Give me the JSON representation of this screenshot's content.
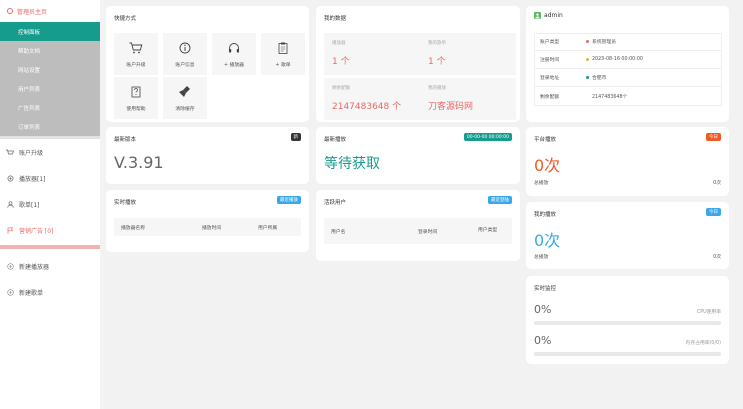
{
  "sidebar": {
    "home": "管理员主页",
    "sub_items": [
      "控制面板",
      "帮助文档",
      "网站设置",
      "用户列表",
      "广告列表",
      "订单列表"
    ],
    "items": [
      {
        "label": "账户升级",
        "icon": "cart-icon"
      },
      {
        "label": "播放器[1]",
        "icon": "gear-icon"
      },
      {
        "label": "歌单[1]",
        "icon": "user-icon"
      },
      {
        "label": "营销广告 [0]",
        "icon": "flag-icon"
      },
      {
        "label": "新建播放器",
        "icon": "plus-circle-icon"
      },
      {
        "label": "新建歌单",
        "icon": "plus-circle-icon"
      }
    ]
  },
  "shortcuts": {
    "title": "快捷方式",
    "items": [
      {
        "label": "账户升级",
        "icon": "cart-icon"
      },
      {
        "label": "账户信息",
        "icon": "info-icon"
      },
      {
        "label": "+ 播放器",
        "icon": "headphones-icon"
      },
      {
        "label": "+ 歌单",
        "icon": "clipboard-icon"
      },
      {
        "label": "使用帮助",
        "icon": "help-icon"
      },
      {
        "label": "清除缓存",
        "icon": "broom-icon"
      }
    ]
  },
  "data_panel": {
    "title": "我的数据",
    "tiles": [
      {
        "label": "播放器",
        "value": "1 个"
      },
      {
        "label": "我的歌单",
        "value": "1 个"
      },
      {
        "label": "剩余配额",
        "value": "2147483648 个"
      },
      {
        "label": "我的播放",
        "value": "刀客源码网"
      }
    ]
  },
  "admin": {
    "name": "admin",
    "rows": [
      {
        "key": "账户类型",
        "value": "系统管理员",
        "dot": "#e86a6a"
      },
      {
        "key": "注册时间",
        "value": "2023-08-16 00:00:00",
        "dot": "#f0b030"
      },
      {
        "key": "登录地址",
        "value": "合肥市",
        "dot": "#169c8c"
      },
      {
        "key": "剩余配额",
        "value": "2147483648个",
        "dot": ""
      }
    ]
  },
  "version": {
    "title": "最新版本",
    "badge": "新",
    "value": "V.3.91"
  },
  "latest_play": {
    "title": "最新播放",
    "badge": "00-00-00 00:00:00",
    "value": "等待获取"
  },
  "platform_play": {
    "title": "平台播放",
    "badge": "今日",
    "value": "0次",
    "total_label": "总播放",
    "total_value": "0次"
  },
  "my_play": {
    "title": "我的播放",
    "badge": "今日",
    "value": "0次",
    "total_label": "总播放",
    "total_value": "0次"
  },
  "realtime_play": {
    "title": "实时播放",
    "badge": "最近播放",
    "columns": [
      "播放器名称",
      "播放时间",
      "用户所属"
    ]
  },
  "active_users": {
    "title": "活跃用户",
    "badge": "最近登陆",
    "columns": [
      "用户名",
      "登录时间",
      "用户类型"
    ]
  },
  "monitor": {
    "title": "实时监控",
    "cpu_value": "0%",
    "cpu_label": "CPU使用率",
    "cpu_level": 0,
    "mem_value": "0%",
    "mem_label": "内存占用率(0/0)",
    "mem_level": 0
  },
  "colors": {
    "teal": "#169c8c",
    "red": "#e86a6a",
    "orange_red": "#ee5a24",
    "blue": "#3aa8e8",
    "dark": "#333333"
  }
}
